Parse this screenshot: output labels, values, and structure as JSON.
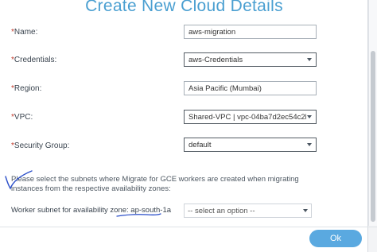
{
  "dialog": {
    "title": "Create New Cloud Details",
    "ok_label": "Ok"
  },
  "fields": [
    {
      "label": "Name:",
      "required_mark": "*",
      "value": "aws-migration",
      "type": "text"
    },
    {
      "label": "Credentials:",
      "required_mark": "*",
      "value": "aws-Credentials",
      "type": "select"
    },
    {
      "label": "Region:",
      "required_mark": "*",
      "value": "Asia Pacific (Mumbai)",
      "type": "text"
    },
    {
      "label": "VPC:",
      "required_mark": "*",
      "value": "Shared-VPC | vpc-04ba7d2ec54c2be5d",
      "type": "select"
    },
    {
      "label": "Security Group:",
      "required_mark": "*",
      "value": "default",
      "type": "select"
    }
  ],
  "subnet_note": "Please select the subnets where Migrate for GCE workers are created when migrating instances from the respective availability zones:",
  "subnet_row": {
    "label": "Worker subnet for availability zone: ap-south-1a",
    "placeholder": "-- select an option --"
  },
  "colors": {
    "title": "#4a9fd1",
    "ok_button": "#5aa9e0",
    "required": "#c0392b",
    "annotation": "#2a4ec9"
  }
}
